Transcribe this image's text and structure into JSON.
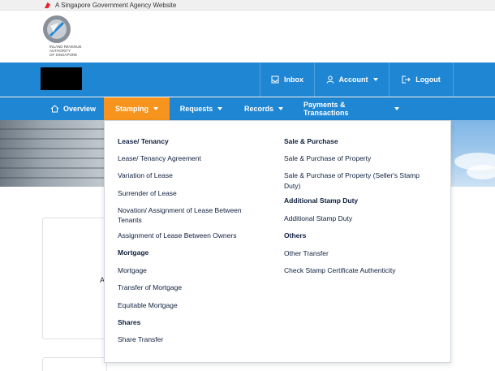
{
  "gov_banner": {
    "text": "A Singapore Government Agency Website"
  },
  "logo": {
    "lines": [
      "INLAND REVENUE",
      "AUTHORITY",
      "OF SINGAPORE"
    ]
  },
  "header": {
    "inbox": "Inbox",
    "account": "Account",
    "logout": "Logout"
  },
  "nav": {
    "overview": "Overview",
    "stamping": "Stamping",
    "requests": "Requests",
    "records": "Records",
    "payments": "Payments & Transactions"
  },
  "dropdown": {
    "left": {
      "lease_heading": "Lease/ Tenancy",
      "lease_items": [
        "Lease/ Tenancy Agreement",
        "Variation of Lease",
        "Surrender of Lease",
        "Novation/ Assignment of Lease Between",
        "Tenants",
        "Assignment of Lease Between Owners"
      ],
      "mortgage_heading": "Mortgage",
      "mortgage_items": [
        "Mortgage",
        "Transfer of Mortgage",
        "Equitable Mortgage"
      ],
      "shares_heading": "Shares",
      "shares_items": [
        "Share Transfer"
      ]
    },
    "right": {
      "sale_heading": "Sale & Purchase",
      "sale_items": [
        "Sale & Purchase of Property",
        "Sale & Purchase of Property (Seller's Stamp",
        "Duty)"
      ],
      "absd_heading": "Additional Stamp Duty",
      "absd_items": [
        "Additional Stamp Duty"
      ],
      "others_heading": "Others",
      "others_items": [
        "Other Transfer",
        "Check Stamp Certificate Authenticity"
      ]
    }
  },
  "background": {
    "partial_letter": "A"
  },
  "colors": {
    "header_blue": "#1f86d4",
    "active_orange": "#f7941d"
  }
}
